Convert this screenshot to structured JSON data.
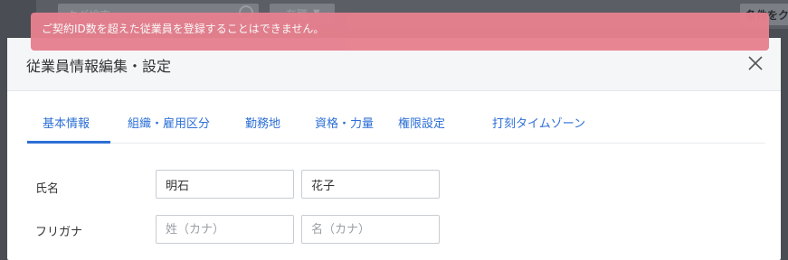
{
  "background": {
    "search_placeholder": "タグ検索",
    "status_select": "在職",
    "condition_button": "条件をク"
  },
  "alert": {
    "message": "ご契約ID数を超えた従業員を登録することはできません。"
  },
  "modal": {
    "title": "従業員情報編集・設定",
    "tabs": [
      {
        "label": "基本情報"
      },
      {
        "label": "組織・雇用区分"
      },
      {
        "label": "勤務地"
      },
      {
        "label": "資格・力量"
      },
      {
        "label": "権限設定"
      },
      {
        "label": "打刻タイムゾーン"
      }
    ],
    "active_tab": "基本情報",
    "form": {
      "name_label": "氏名",
      "last_name_value": "明石",
      "first_name_value": "花子",
      "furigana_label": "フリガナ",
      "last_name_kana_placeholder": "姓（カナ）",
      "first_name_kana_placeholder": "名（カナ）"
    }
  },
  "colors": {
    "accent": "#2d6fd6",
    "alert_bg": "#e7808f"
  }
}
